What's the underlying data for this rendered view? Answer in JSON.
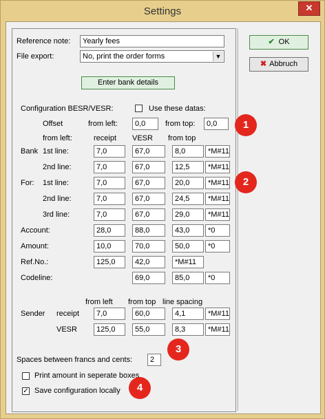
{
  "window": {
    "title": "Settings",
    "close_glyph": "✕"
  },
  "reference": {
    "label": "Reference note:",
    "value": "Yearly fees"
  },
  "file_export": {
    "label": "File export:",
    "value": "No, print the order forms"
  },
  "bank_button": "Enter bank details",
  "config": {
    "label": "Configuration BESR/VESR:",
    "use_label": "Use these datas:"
  },
  "offset": {
    "label": "Offset",
    "from_left_label": "from left:",
    "from_left": "0,0",
    "from_top_label": "from top:",
    "from_top": "0,0"
  },
  "headers": {
    "from_left": "from left:",
    "receipt": "receipt",
    "vesr": "VESR",
    "from_top": "from top"
  },
  "labels": {
    "bank": "Bank",
    "line1": "1st line:",
    "line2": "2nd line:",
    "for": "For:",
    "for1": "1st line:",
    "for2": "2nd line:",
    "for3": "3rd line:",
    "account": "Account:",
    "amount": "Amount:",
    "refno": "Ref.No.:",
    "codeline": "Codeline:"
  },
  "values": {
    "bank1": [
      "7,0",
      "67,0",
      "8,0",
      "*M#11"
    ],
    "bank2": [
      "7,0",
      "67,0",
      "12,5",
      "*M#11"
    ],
    "for1": [
      "7,0",
      "67,0",
      "20,0",
      "*M#11"
    ],
    "for2": [
      "7,0",
      "67,0",
      "24,5",
      "*M#11"
    ],
    "for3": [
      "7,0",
      "67,0",
      "29,0",
      "*M#11"
    ],
    "account": [
      "28,0",
      "88,0",
      "43,0",
      "*0"
    ],
    "amount": [
      "10,0",
      "70,0",
      "50,0",
      "*0"
    ],
    "refno": [
      "125,0",
      "42,0",
      "*M#11"
    ],
    "codeline": [
      "69,0",
      "85,0",
      "*0"
    ]
  },
  "sender": {
    "label": "Sender",
    "from_left": "from left",
    "from_top": "from top",
    "line_spacing": "line spacing",
    "receipt_label": "receipt",
    "receipt": [
      "7,0",
      "60,0",
      "4,1",
      "*M#11"
    ],
    "vesr_label": "VESR",
    "vesr": [
      "125,0",
      "55,0",
      "8,3",
      "*M#11"
    ]
  },
  "spaces": {
    "label": "Spaces between francs and cents:",
    "value": "2"
  },
  "print_separate": {
    "label": "Print amount in seperate boxes",
    "checked": false
  },
  "save_local": {
    "label": "Save configuration locally",
    "checked": true
  },
  "ok_button": "OK",
  "cancel_button": "Abbruch",
  "badges": [
    "1",
    "2",
    "3",
    "4"
  ]
}
